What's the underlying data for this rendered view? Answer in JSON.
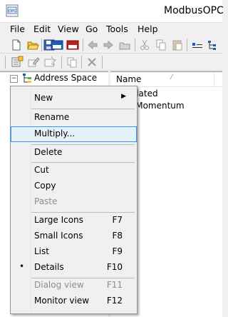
{
  "window": {
    "title": "ModbusOPC"
  },
  "app_icon": {
    "label": "OPC"
  },
  "menubar": [
    "File",
    "Edit",
    "View",
    "Go",
    "Tools",
    "Help"
  ],
  "tree": {
    "root_label": "Address Space",
    "expander": "−"
  },
  "list": {
    "column_header": "Name",
    "items": [
      "Simulated",
      "TSX_Momentum"
    ],
    "visible_fragments": [
      "nulated",
      "X_Momentum"
    ]
  },
  "context_menu": {
    "items": [
      {
        "label": "New",
        "submenu": true
      },
      {
        "separator": true
      },
      {
        "label": "Rename"
      },
      {
        "label": "Multiply...",
        "highlighted": true
      },
      {
        "separator": true
      },
      {
        "label": "Delete"
      },
      {
        "separator": true
      },
      {
        "label": "Cut"
      },
      {
        "label": "Copy"
      },
      {
        "label": "Paste",
        "disabled": true
      },
      {
        "separator": true
      },
      {
        "label": "Large Icons",
        "shortcut": "F7"
      },
      {
        "label": "Small Icons",
        "shortcut": "F8"
      },
      {
        "label": "List",
        "shortcut": "F9"
      },
      {
        "label": "Details",
        "shortcut": "F10",
        "checked": true
      },
      {
        "separator": true
      },
      {
        "label": "Dialog view",
        "shortcut": "F11",
        "disabled": true
      },
      {
        "label": "Monitor view",
        "shortcut": "F12"
      }
    ]
  },
  "colors": {
    "highlight_border": "#3399ff",
    "highlight_fill": "#e5f1fb",
    "menu_bg": "#f0f0f0",
    "selection": "#3399ff"
  }
}
